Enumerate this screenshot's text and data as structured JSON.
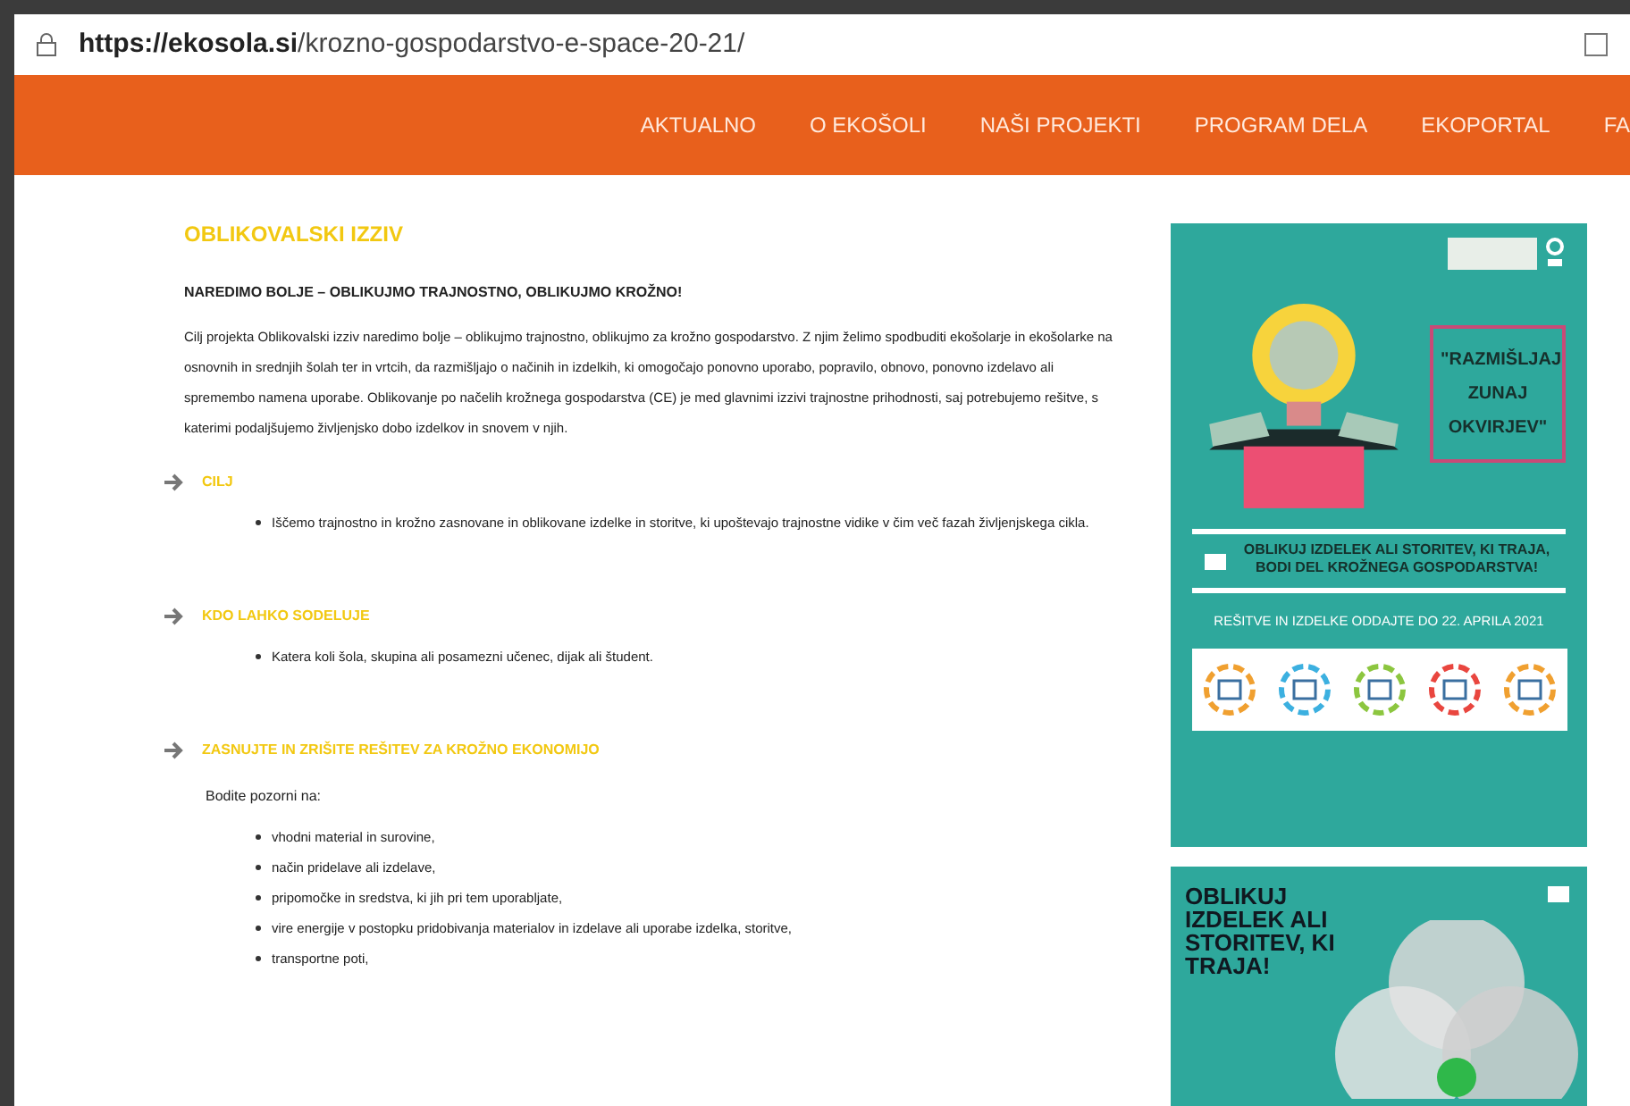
{
  "browser": {
    "url_domain": "https://ekosola.si",
    "url_path": "/krozno-gospodarstvo-e-space-20-21/"
  },
  "nav": {
    "items": [
      {
        "label": "AKTUALNO"
      },
      {
        "label": "O EKOŠOLI"
      },
      {
        "label": "NAŠI PROJEKTI"
      },
      {
        "label": "PROGRAM DELA"
      },
      {
        "label": "EKOPORTAL"
      },
      {
        "label": "FA"
      }
    ]
  },
  "article": {
    "title": "OBLIKOVALSKI IZZIV",
    "subtitle": "NAREDIMO BOLJE – OBLIKUJMO TRAJNOSTNO, OBLIKUJMO KROŽNO!",
    "intro": "Cilj projekta Oblikovalski izziv naredimo bolje – oblikujmo trajnostno, oblikujmo za krožno gospodarstvo. Z njim želimo spodbuditi ekošolarje in ekošolarke na osnovnih in srednjih šolah ter in vrtcih, da razmišljajo o načinih in izdelkih, ki omogočajo ponovno uporabo, popravilo, obnovo, ponovno izdelavo ali spremembo namena uporabe. Oblikovanje po načelih krožnega gospodarstva (CE) je med glavnimi izzivi trajnostne prihodnosti, saj potrebujemo rešitve, s katerimi podaljšujemo življenjsko dobo izdelkov in snovem v njih.",
    "sections": [
      {
        "heading": "CILJ",
        "bullets": [
          "Iščemo trajnostno in krožno zasnovane in oblikovane izdelke in storitve, ki upoštevajo trajnostne vidike v čim več fazah življenjskega cikla."
        ]
      },
      {
        "heading": "KDO LAHKO SODELUJE",
        "bullets": [
          "Katera koli šola, skupina ali posamezni učenec, dijak ali študent."
        ]
      },
      {
        "heading": "ZASNUJTE IN ZRIŠITE REŠITEV ZA KROŽNO EKONOMIJO",
        "lead": "Bodite pozorni na:",
        "bullets": [
          "vhodni material in surovine,",
          "način pridelave ali izdelave,",
          "pripomočke in sredstva, ki jih pri tem uporabljate,",
          "vire energije v postopku pridobivanja materialov in izdelave ali uporabe izdelka, storitve,",
          "transportne poti,"
        ]
      }
    ]
  },
  "poster_1": {
    "quote": "\"RAZMIŠLJAJ ZUNAJ OKVIRJEV\"",
    "headline": "OBLIKUJ IZDELEK ALI STORITEV, KI TRAJA, BODI DEL KROŽNEGA GOSPODARSTVA!",
    "deadline": "REŠITVE IN IZDELKE ODDAJTE DO 22. APRILA 2021"
  },
  "poster_2": {
    "headline": "OBLIKUJ IZDELEK ALI STORITEV, KI TRAJA!"
  }
}
